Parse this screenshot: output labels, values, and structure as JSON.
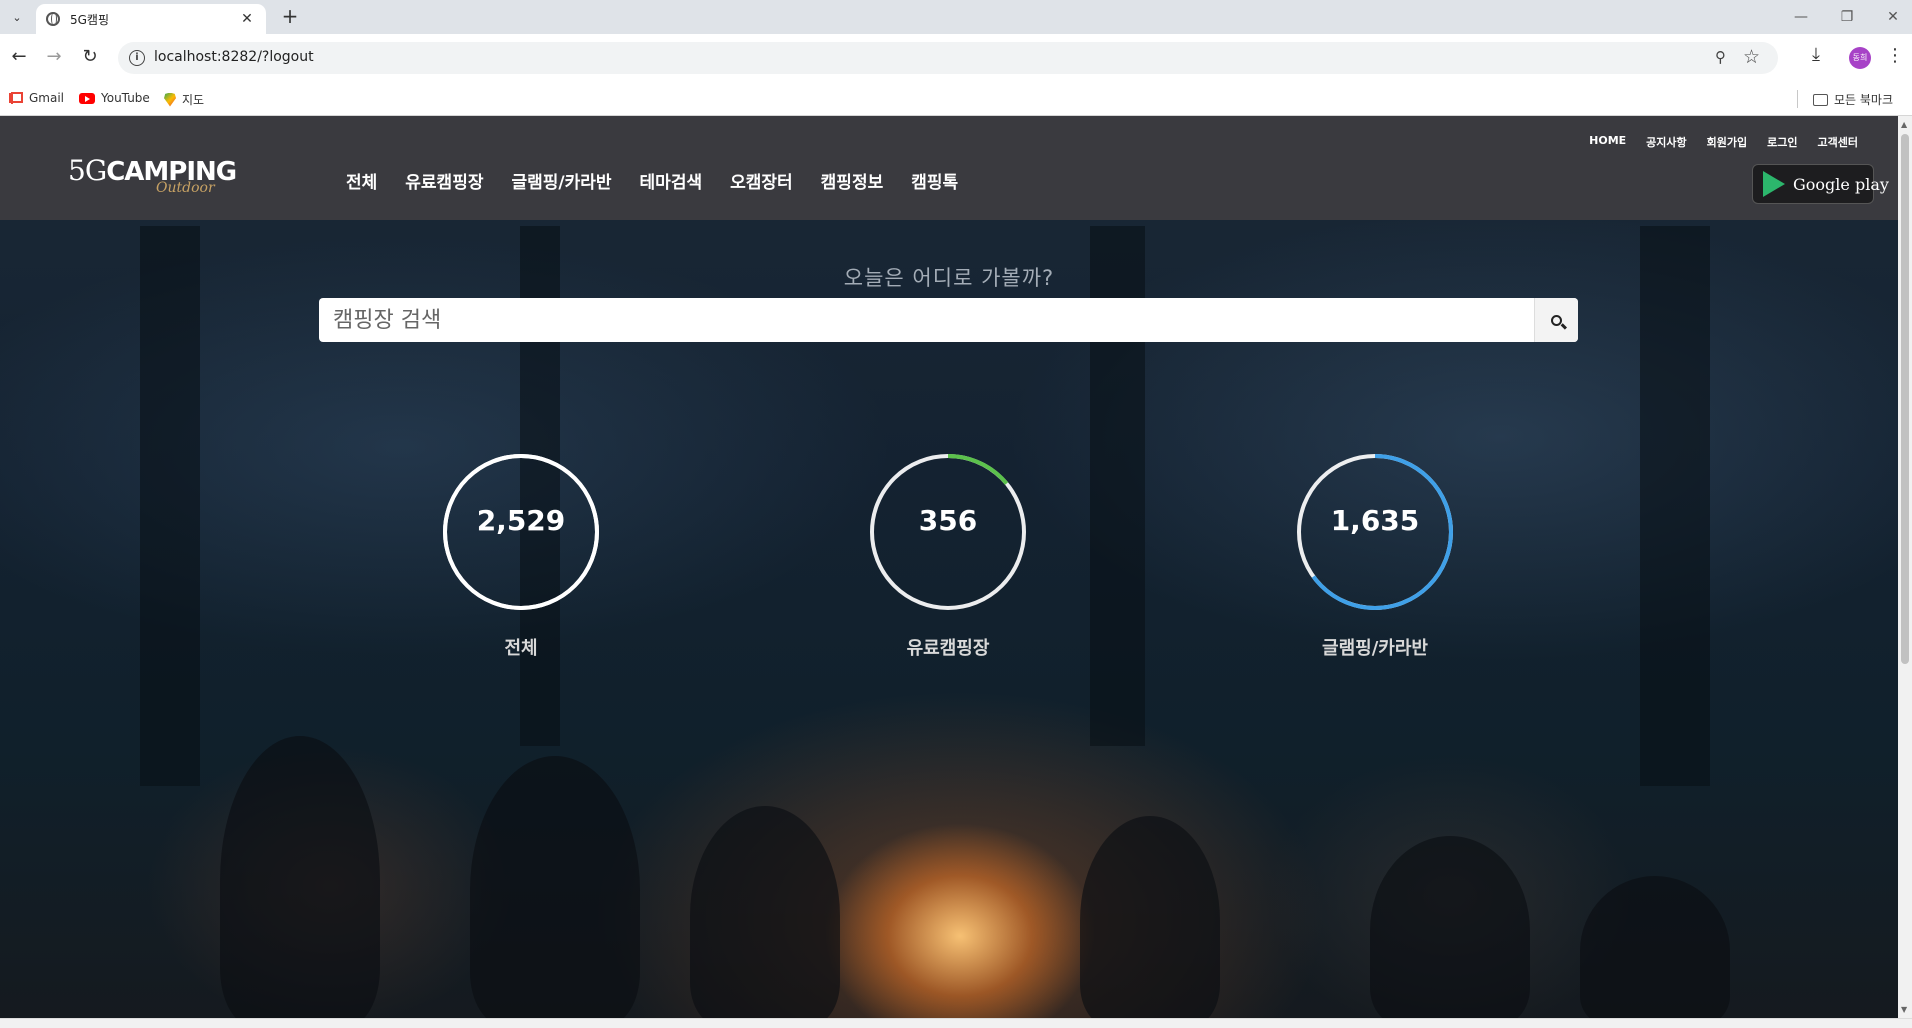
{
  "browser": {
    "tab_title": "5G캠핑",
    "url": "localhost:8282/?logout",
    "bookmarks": [
      {
        "label": "Gmail",
        "icon": "gmail-icon"
      },
      {
        "label": "YouTube",
        "icon": "youtube-icon"
      },
      {
        "label": "지도",
        "icon": "maps-icon"
      }
    ],
    "all_bookmarks_label": "모든 북마크",
    "profile_initials": "동희"
  },
  "header": {
    "logo_text": "5GCAMPING",
    "logo_mark": "5G",
    "logo_word": "CAMPING",
    "logo_sub": "Outdoor",
    "nav": [
      "전체",
      "유료캠핑장",
      "글램핑/카라반",
      "테마검색",
      "오캠장터",
      "캠핑정보",
      "캠핑톡"
    ],
    "util": [
      "HOME",
      "공지사항",
      "회원가입",
      "로그인",
      "고객센터"
    ],
    "store_badge": "Google play"
  },
  "hero": {
    "tagline": "오늘은 어디로 가볼까?",
    "search_placeholder": "캠핑장 검색"
  },
  "stats": [
    {
      "value": "2,529",
      "label": "전체",
      "progress": 1.0,
      "color": "#ffffff"
    },
    {
      "value": "356",
      "label": "유료캠핑장",
      "progress": 0.14,
      "color": "#5cc14c"
    },
    {
      "value": "1,635",
      "label": "글램핑/카라반",
      "progress": 0.65,
      "color": "#3fa0e8"
    }
  ],
  "colors": {
    "header_bg": "#3a3a3f",
    "accent_green": "#5cc14c",
    "accent_blue": "#3fa0e8"
  }
}
